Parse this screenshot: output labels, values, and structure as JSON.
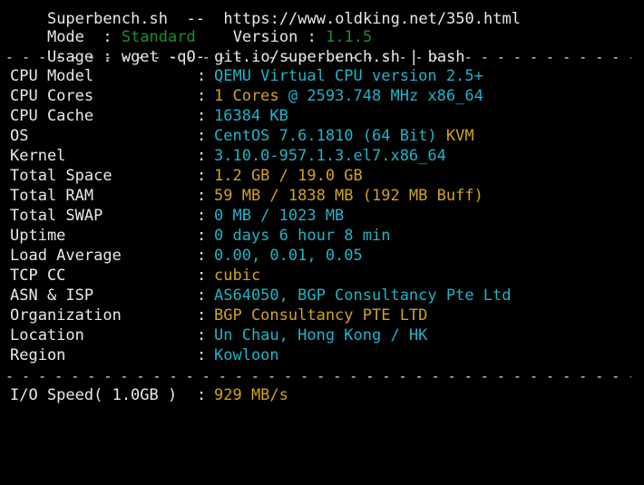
{
  "header": {
    "line0": "Superbench.sh  --  https://www.oldking.net/350.html",
    "mode_label": "Mode  : ",
    "mode_value": "Standard",
    "version_label": "Version : ",
    "version_value": "1.1.5",
    "usage": "Usage : wget -qO- git.io/superbench.sh | bash"
  },
  "separator": "- - - - - - - - - - - - - - - - - - - - - - - - - - - - - - - - - - - - - - - - - - - - - - - - - - - - - - - - - - - - - - - - - - - - - - - - - - - - - - - - - - - - - - - - - - - - - - - - - - - - - - - - - -",
  "colon": ":",
  "rows": [
    {
      "label": "CPU Model",
      "value": "QEMU Virtual CPU version 2.5+"
    },
    {
      "label": "CPU Cores",
      "value_a": "1 Cores",
      "value_b": "@ 2593.748 MHz x86_64"
    },
    {
      "label": "CPU Cache",
      "value": "16384 KB"
    },
    {
      "label": "OS",
      "value_a": "CentOS 7.6.1810 (64 Bit)",
      "value_b": "KVM"
    },
    {
      "label": "Kernel",
      "value": "3.10.0-957.1.3.el7.x86_64"
    },
    {
      "label": "Total Space",
      "value": "1.2 GB / 19.0 GB"
    },
    {
      "label": "Total RAM",
      "value": "59 MB / 1838 MB (192 MB Buff)"
    },
    {
      "label": "Total SWAP",
      "value": "0 MB / 1023 MB"
    },
    {
      "label": "Uptime",
      "value": "0 days 6 hour 8 min"
    },
    {
      "label": "Load Average",
      "value": "0.00, 0.01, 0.05"
    },
    {
      "label": "TCP CC",
      "value": "cubic"
    },
    {
      "label": "ASN & ISP",
      "value": "AS64050, BGP Consultancy Pte Ltd"
    },
    {
      "label": "Organization",
      "value": "BGP Consultancy PTE LTD"
    },
    {
      "label": "Location",
      "value": "Un Chau, Hong Kong / HK"
    },
    {
      "label": "Region",
      "value": "Kowloon"
    }
  ],
  "io": {
    "label": "I/O Speed( 1.0GB )",
    "value": "929 MB/s"
  }
}
